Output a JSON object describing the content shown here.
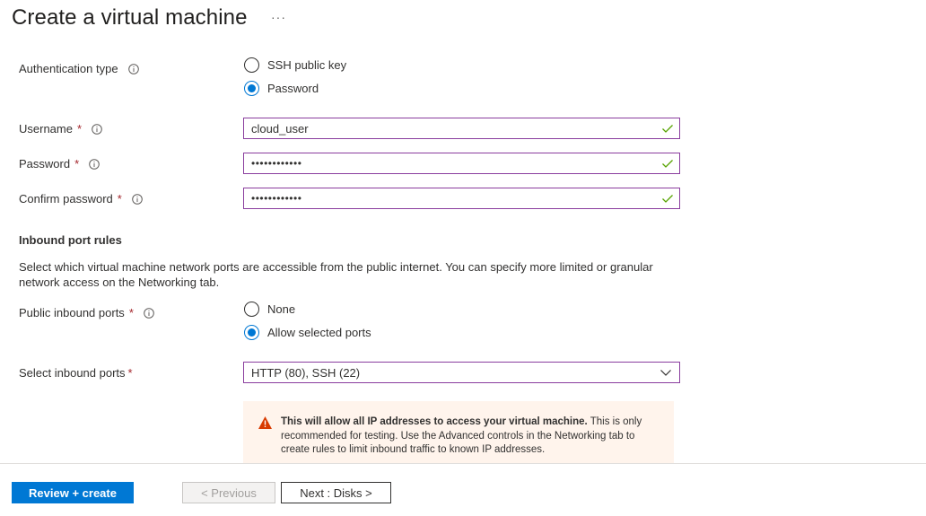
{
  "page": {
    "title": "Create a virtual machine",
    "more_label": "···"
  },
  "auth": {
    "label": "Authentication type",
    "options": [
      "SSH public key",
      "Password"
    ],
    "selected": "Password"
  },
  "username": {
    "label": "Username",
    "required_mark": "*",
    "value": "cloud_user"
  },
  "password": {
    "label": "Password",
    "required_mark": "*",
    "value": "••••••••••••"
  },
  "confirm_password": {
    "label": "Confirm password",
    "required_mark": "*",
    "value": "••••••••••••"
  },
  "inbound": {
    "title": "Inbound port rules",
    "description": "Select which virtual machine network ports are accessible from the public internet. You can specify more limited or granular network access on the Networking tab.",
    "public_label": "Public inbound ports",
    "public_required_mark": "*",
    "public_options": [
      "None",
      "Allow selected ports"
    ],
    "public_selected": "Allow selected ports",
    "select_label": "Select inbound ports",
    "select_required_mark": "*",
    "select_value": "HTTP (80), SSH (22)"
  },
  "warning": {
    "bold": "This will allow all IP addresses to access your virtual machine.",
    "text": " This is only recommended for testing.  Use the Advanced controls in the Networking tab to create rules to limit inbound traffic to known IP addresses."
  },
  "footer": {
    "review_label": "Review + create",
    "previous_label": "< Previous",
    "next_label": "Next : Disks >"
  },
  "colors": {
    "accent": "#0078d4",
    "field_border": "#8a3d9e",
    "valid_check": "#57a300",
    "warning_bg": "#fff4ec",
    "warning_icon": "#d83b01",
    "required": "#a4262c"
  },
  "icons": {
    "info": "info-icon",
    "valid": "checkmark-icon",
    "dropdown": "chevron-down-icon",
    "warning": "warning-icon",
    "more": "ellipsis-icon"
  }
}
